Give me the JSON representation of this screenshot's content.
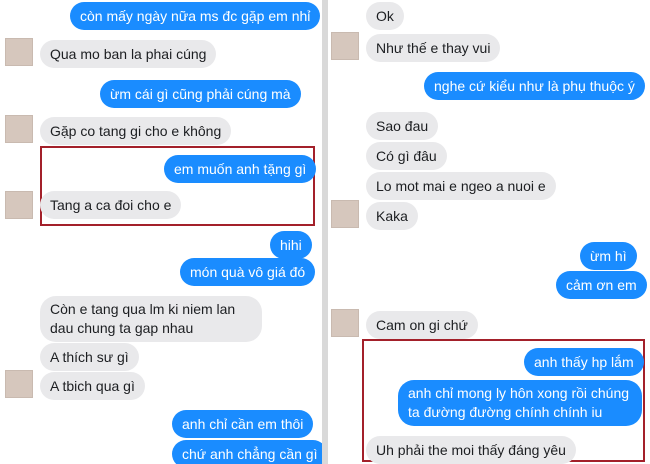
{
  "left_panel": {
    "messages": [
      {
        "text": "còn mấy ngày nữa ms đc gặp em nhỉ"
      },
      {
        "text": "Qua mo ban la phai cúng"
      },
      {
        "text": "ừm cái gì cũng phải cúng mà"
      },
      {
        "text": "Gặp co tang gi cho e không"
      },
      {
        "text": "em muốn anh tặng gì"
      },
      {
        "text": "Tang a ca đoi cho e"
      },
      {
        "text": "hihi"
      },
      {
        "text": "món quà vô giá đó"
      },
      {
        "text": "Còn e tang qua lm ki niem lan dau chung ta gap nhau"
      },
      {
        "text": "A thích sư gì"
      },
      {
        "text": "A tbich qua gì"
      },
      {
        "text": "anh chỉ cần em thôi"
      },
      {
        "text": "chứ anh chẳng cần gì"
      }
    ]
  },
  "right_panel": {
    "messages": [
      {
        "text": "Ok"
      },
      {
        "text": "Như thế e thay  vui"
      },
      {
        "text": "nghe cứ kiểu như là phụ thuộc ý"
      },
      {
        "text": "Sao đau"
      },
      {
        "text": "Có gì đâu"
      },
      {
        "text": "Lo mot mai e ngeo a nuoi e"
      },
      {
        "text": "Kaka"
      },
      {
        "text": "ừm hì"
      },
      {
        "text": "cảm ơn em"
      },
      {
        "text": "Cam on gi chứ"
      },
      {
        "text": "anh thấy hp lắm"
      },
      {
        "text": "anh chỉ mong ly hôn xong rồi chúng ta đường đường chính chính iu nhau"
      },
      {
        "text": "Uh phải the moi thấy đáng yêu"
      }
    ]
  },
  "colors": {
    "incoming_bubble": "#e9e9eb",
    "outgoing_bubble": "#1a8cff",
    "highlight_box": "#a3202a"
  }
}
